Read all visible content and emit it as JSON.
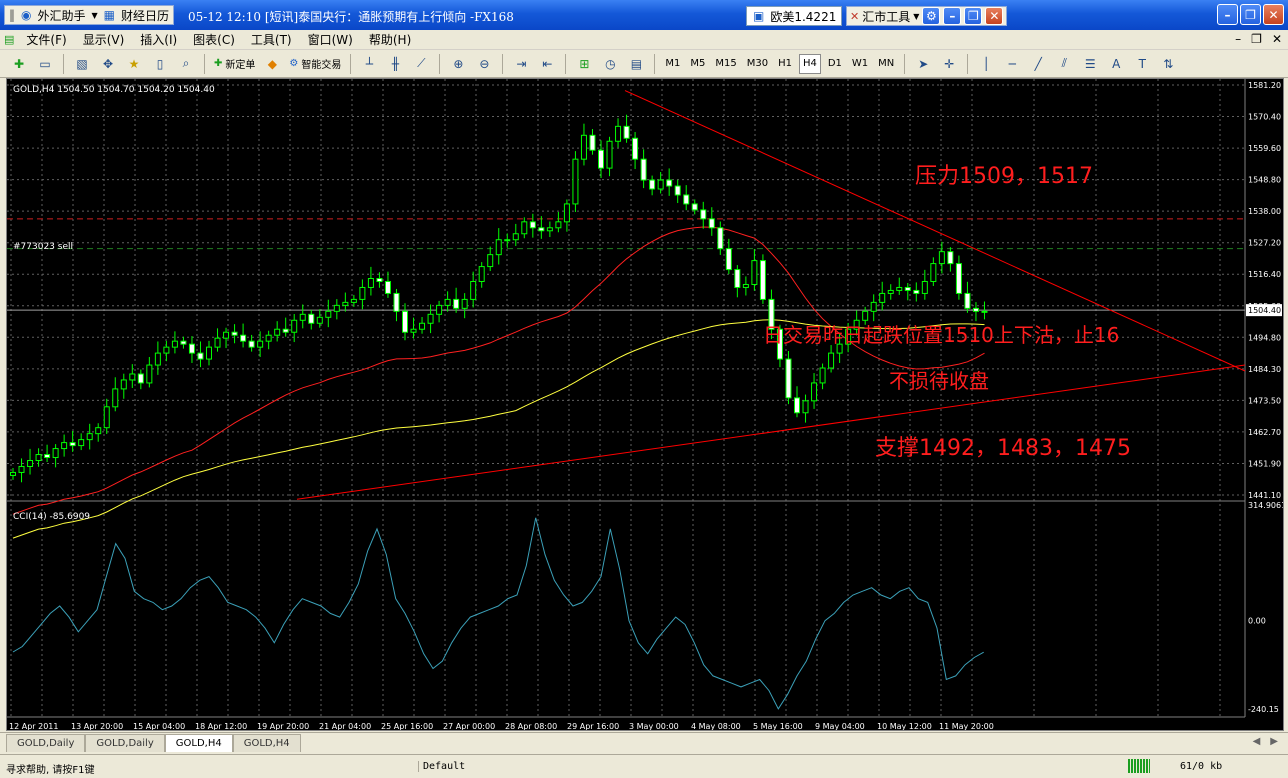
{
  "titlebar": {
    "app_button": "外汇助手",
    "calendar_button": "财经日历",
    "news_time": "05-12 12:10",
    "news_text": "[短讯]泰国央行：通胀预期有上行倾向",
    "news_source": "-FX168",
    "quote_text": "欧美1.4221",
    "tools_label": "汇市工具"
  },
  "menu": {
    "items": [
      "文件(F)",
      "显示(V)",
      "插入(I)",
      "图表(C)",
      "工具(T)",
      "窗口(W)",
      "帮助(H)"
    ]
  },
  "toolbar": {
    "new_order": "新定单",
    "expert": "智能交易",
    "timeframes": [
      "M1",
      "M5",
      "M15",
      "M30",
      "H1",
      "H4",
      "D1",
      "W1",
      "MN"
    ],
    "active_timeframe": "H4"
  },
  "chart": {
    "header": "GOLD,H4  1504.50 1504.70 1504.20 1504.40",
    "order_label": "#773023 sell",
    "current_price": "1504.40",
    "price_ticks": [
      "1581.20",
      "1570.40",
      "1559.60",
      "1548.80",
      "1538.00",
      "1527.20",
      "1516.40",
      "1505.60",
      "1494.80",
      "1484.30",
      "1473.50",
      "1462.70",
      "1451.90",
      "1441.10"
    ],
    "annotations": {
      "resistance": "压力1509，1517",
      "strategy_line1": "日交易昨日起跌位置1510上下沽，止16",
      "strategy_line2": "不损待收盘",
      "support": "支撑1492，1483，1475"
    },
    "indicator": {
      "label": "CCI(14) -85.6909",
      "ticks": [
        "314.9061",
        "0.00",
        "-240.15"
      ]
    },
    "time_ticks": [
      "12 Apr 2011",
      "13 Apr 20:00",
      "15 Apr 04:00",
      "18 Apr 12:00",
      "19 Apr 20:00",
      "21 Apr 04:00",
      "25 Apr 16:00",
      "27 Apr 00:00",
      "28 Apr 08:00",
      "29 Apr 16:00",
      "3 May 00:00",
      "4 May 08:00",
      "5 May 16:00",
      "9 May 04:00",
      "10 May 12:00",
      "11 May 20:00"
    ]
  },
  "chart_data": {
    "type": "candlestick",
    "symbol": "GOLD",
    "timeframe": "H4",
    "ylim": [
      1441.1,
      1581.2
    ],
    "candles_close": [
      1450,
      1452,
      1454,
      1456,
      1455,
      1458,
      1460,
      1459,
      1461,
      1463,
      1465,
      1472,
      1478,
      1481,
      1483,
      1480,
      1486,
      1490,
      1492,
      1494,
      1493,
      1490,
      1488,
      1492,
      1495,
      1497,
      1496,
      1494,
      1492,
      1494,
      1496,
      1498,
      1497,
      1501,
      1503,
      1500,
      1502,
      1504,
      1506,
      1507,
      1508,
      1512,
      1515,
      1514,
      1510,
      1504,
      1497,
      1498,
      1500,
      1503,
      1506,
      1508,
      1505,
      1508,
      1514,
      1519,
      1523,
      1528,
      1528,
      1530,
      1534,
      1532,
      1531,
      1532,
      1534,
      1540,
      1555,
      1563,
      1558,
      1552,
      1561,
      1566,
      1562,
      1555,
      1548,
      1545,
      1548,
      1546,
      1543,
      1540,
      1538,
      1535,
      1532,
      1525,
      1518,
      1512,
      1513,
      1521,
      1508,
      1498,
      1488,
      1475,
      1470,
      1474,
      1480,
      1485,
      1490,
      1493,
      1498,
      1501,
      1504,
      1507,
      1510,
      1511,
      1512,
      1511,
      1510,
      1514,
      1520,
      1524,
      1520,
      1510,
      1505,
      1504,
      1504
    ],
    "cci14": [
      -85,
      -70,
      -40,
      -10,
      20,
      40,
      10,
      -30,
      0,
      30,
      120,
      210,
      170,
      80,
      60,
      50,
      30,
      40,
      60,
      90,
      110,
      120,
      90,
      50,
      40,
      30,
      10,
      -20,
      -60,
      -10,
      30,
      60,
      50,
      40,
      20,
      10,
      50,
      100,
      190,
      250,
      180,
      60,
      20,
      -30,
      -90,
      -130,
      -110,
      -60,
      -20,
      10,
      20,
      30,
      40,
      60,
      70,
      150,
      280,
      180,
      110,
      70,
      40,
      50,
      80,
      120,
      250,
      140,
      0,
      -60,
      -90,
      -50,
      -20,
      10,
      -10,
      -60,
      -120,
      -150,
      -160,
      -170,
      -180,
      -170,
      -160,
      -190,
      -240,
      -200,
      -150,
      -110,
      -50,
      0,
      20,
      50,
      70,
      80,
      90,
      70,
      60,
      80,
      90,
      60,
      50,
      -20,
      -160,
      -150,
      -120,
      -100,
      -85.69
    ],
    "annotations": [
      "压力1509，1517",
      "日交易昨日起跌位置1510上下沽，止16",
      "不损待收盘",
      "支撑1492，1483，1475"
    ],
    "grid": true
  },
  "tabs": [
    "GOLD,Daily",
    "GOLD,Daily",
    "GOLD,H4",
    "GOLD,H4"
  ],
  "active_tab": 2,
  "status": {
    "help": "寻求帮助, 请按F1键",
    "profile": "Default",
    "traffic": "61/0 kb"
  },
  "colors": {
    "candle_up": "#00FF00",
    "ma_red": "#FF2020",
    "ma_yellow": "#FFFF40",
    "trendline": "#FF0000",
    "annotation": "#FF0000",
    "cci": "#3BA0B8",
    "grid": "#606060"
  }
}
